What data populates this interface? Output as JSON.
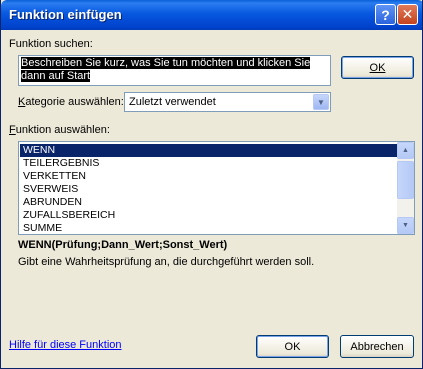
{
  "window": {
    "title": "Funktion einfügen",
    "help_button": "?",
    "close_button": "✕"
  },
  "search": {
    "label": "Funktion suchen:",
    "value": "Beschreiben Sie kurz, was Sie tun möchten und klicken Sie dann auf Start",
    "go_button": "OK"
  },
  "category": {
    "label_prefix": "",
    "label_mnemonic": "K",
    "label_rest": "ategorie auswählen:",
    "selected": "Zuletzt verwendet"
  },
  "function_list": {
    "label_mnemonic": "F",
    "label_rest": "unktion auswählen:",
    "items": [
      "WENN",
      "TEILERGEBNIS",
      "VERKETTEN",
      "SVERWEIS",
      "ABRUNDEN",
      "ZUFALLSBEREICH",
      "SUMME"
    ],
    "selected_index": 0
  },
  "details": {
    "signature": "WENN(Prüfung;Dann_Wert;Sonst_Wert)",
    "description": "Gibt eine Wahrheitsprüfung an, die durchgeführt werden soll."
  },
  "footer": {
    "help_link": "Hilfe für diese Funktion",
    "ok_label": "OK",
    "cancel_label": "Abbrechen"
  }
}
